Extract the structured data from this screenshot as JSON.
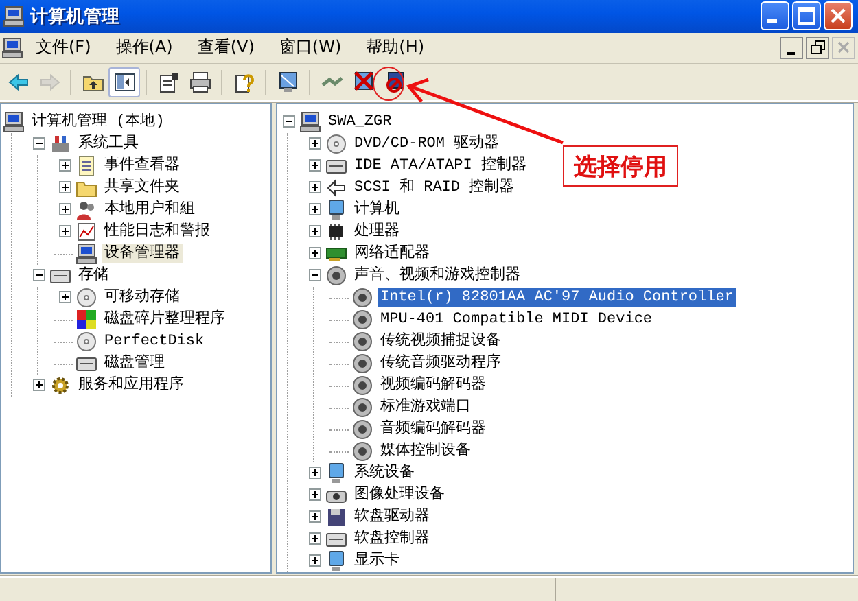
{
  "window": {
    "title": "计算机管理"
  },
  "menu": [
    "文件(F)",
    "操作(A)",
    "查看(V)",
    "窗口(W)",
    "帮助(H)"
  ],
  "child_window_buttons": [
    {
      "kind": "minimize",
      "disabled": false
    },
    {
      "kind": "restore",
      "disabled": false
    },
    {
      "kind": "close",
      "disabled": true
    }
  ],
  "toolbar": [
    {
      "kind": "back",
      "disabled": false,
      "pressed": false
    },
    {
      "kind": "forward",
      "disabled": true,
      "pressed": false
    },
    {
      "kind": "separator"
    },
    {
      "kind": "up",
      "disabled": false,
      "pressed": false
    },
    {
      "kind": "tree-toggle",
      "disabled": false,
      "pressed": true
    },
    {
      "kind": "separator"
    },
    {
      "kind": "properties",
      "disabled": false,
      "pressed": false
    },
    {
      "kind": "print",
      "disabled": false,
      "pressed": false
    },
    {
      "kind": "separator"
    },
    {
      "kind": "help",
      "disabled": false,
      "pressed": false
    },
    {
      "kind": "separator"
    },
    {
      "kind": "scan",
      "disabled": false,
      "pressed": false
    },
    {
      "kind": "separator"
    },
    {
      "kind": "plug",
      "disabled": false,
      "pressed": false
    },
    {
      "kind": "uninstall",
      "disabled": false,
      "pressed": false
    },
    {
      "kind": "disable",
      "disabled": false,
      "pressed": false
    }
  ],
  "console_tree": {
    "focused": false,
    "items": [
      {
        "label": "计算机管理 (本地)",
        "kind": "computer",
        "selected": false,
        "children": [
          {
            "label": "系统工具",
            "kind": "tools",
            "expanded": true,
            "selected": false,
            "children": [
              {
                "label": "事件查看器",
                "kind": "log",
                "expanded": false,
                "selected": false
              },
              {
                "label": "共享文件夹",
                "kind": "folder",
                "expanded": false,
                "selected": false
              },
              {
                "label": "本地用户和組",
                "kind": "users",
                "expanded": false,
                "selected": false
              },
              {
                "label": "性能日志和警报",
                "kind": "chart",
                "expanded": false,
                "selected": false
              },
              {
                "label": "设备管理器",
                "kind": "computer",
                "selected": true
              }
            ]
          },
          {
            "label": "存储",
            "kind": "drive",
            "expanded": true,
            "selected": false,
            "children": [
              {
                "label": "可移动存储",
                "kind": "disc",
                "expanded": false,
                "selected": false
              },
              {
                "label": "磁盘碎片整理程序",
                "kind": "blocks",
                "selected": false
              },
              {
                "label": "PerfectDisk",
                "kind": "disc",
                "selected": false
              },
              {
                "label": "磁盘管理",
                "kind": "drive",
                "selected": false
              }
            ]
          },
          {
            "label": "服务和应用程序",
            "kind": "gear",
            "expanded": false,
            "selected": false
          }
        ]
      }
    ]
  },
  "device_tree": {
    "focused": true,
    "items": [
      {
        "label": "SWA_ZGR",
        "kind": "computer",
        "expanded": true,
        "selected": false,
        "children": [
          {
            "label": "DVD/CD-ROM 驱动器",
            "kind": "disc",
            "expanded": false,
            "selected": false
          },
          {
            "label": "IDE ATA/ATAPI 控制器",
            "kind": "drive",
            "expanded": false,
            "selected": false
          },
          {
            "label": "SCSI 和 RAID 控制器",
            "kind": "connector",
            "expanded": false,
            "selected": false
          },
          {
            "label": "计算机",
            "kind": "monitor",
            "expanded": false,
            "selected": false
          },
          {
            "label": "处理器",
            "kind": "chip",
            "expanded": false,
            "selected": false
          },
          {
            "label": "网络适配器",
            "kind": "card",
            "expanded": false,
            "selected": false
          },
          {
            "label": "声音、视频和游戏控制器",
            "kind": "speaker",
            "expanded": true,
            "selected": false,
            "children": [
              {
                "label": "Intel(r) 82801AA AC'97 Audio Controller",
                "kind": "speaker",
                "selected": true
              },
              {
                "label": "MPU-401 Compatible MIDI Device",
                "kind": "speaker",
                "selected": false
              },
              {
                "label": "传统视频捕捉设备",
                "kind": "speaker",
                "selected": false
              },
              {
                "label": "传统音频驱动程序",
                "kind": "speaker",
                "selected": false
              },
              {
                "label": "视频编码解码器",
                "kind": "speaker",
                "selected": false
              },
              {
                "label": "标准游戏端口",
                "kind": "speaker",
                "selected": false
              },
              {
                "label": "音频编码解码器",
                "kind": "speaker",
                "selected": false
              },
              {
                "label": "媒体控制设备",
                "kind": "speaker",
                "selected": false
              }
            ]
          },
          {
            "label": "系统设备",
            "kind": "monitor",
            "expanded": false,
            "selected": false
          },
          {
            "label": "图像处理设备",
            "kind": "camera",
            "expanded": false,
            "selected": false
          },
          {
            "label": "软盘驱动器",
            "kind": "floppy",
            "expanded": false,
            "selected": false
          },
          {
            "label": "软盘控制器",
            "kind": "drive",
            "expanded": false,
            "selected": false
          },
          {
            "label": "显示卡",
            "kind": "monitor",
            "expanded": false,
            "selected": false
          }
        ]
      }
    ]
  },
  "annotation": {
    "label": "选择停用"
  }
}
